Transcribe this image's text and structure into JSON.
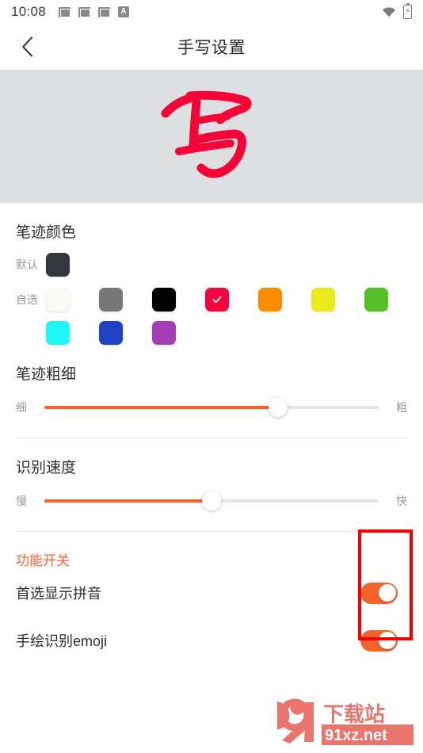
{
  "statusbar": {
    "time": "10:08",
    "left_icons": [
      "mail-icon",
      "mail-icon",
      "mail-icon",
      "a-badge-icon"
    ],
    "right_icons": [
      "wifi-icon",
      "battery-charging-icon"
    ]
  },
  "header": {
    "title": "手写设置",
    "back_icon": "chevron-left-icon"
  },
  "preview": {
    "character": "写",
    "ink_color": "#f50537",
    "background": "#dedfe0"
  },
  "ink_color_section": {
    "title": "笔迹颜色",
    "default_label": "默认",
    "custom_label": "自选",
    "default_swatch": {
      "name": "charcoal",
      "hex": "#33363c",
      "selected": false
    },
    "custom_swatches_row1": [
      {
        "name": "white",
        "hex": "#fafaf5",
        "selected": false
      },
      {
        "name": "gray",
        "hex": "#777777",
        "selected": false
      },
      {
        "name": "black",
        "hex": "#000000",
        "selected": false
      },
      {
        "name": "red",
        "hex": "#f50540",
        "selected": true
      },
      {
        "name": "orange",
        "hex": "#fb8c00",
        "selected": false
      },
      {
        "name": "yellow",
        "hex": "#e8ea1c",
        "selected": false
      },
      {
        "name": "green",
        "hex": "#55bf26",
        "selected": false
      }
    ],
    "custom_swatches_row2": [
      {
        "name": "cyan",
        "hex": "#1ff6f6",
        "selected": false
      },
      {
        "name": "blue",
        "hex": "#1e42c4",
        "selected": false
      },
      {
        "name": "purple",
        "hex": "#a33cb5",
        "selected": false
      }
    ]
  },
  "stroke_width_section": {
    "title": "笔迹粗细",
    "min_label": "细",
    "max_label": "粗",
    "value_percent": 70
  },
  "recognition_speed_section": {
    "title": "识别速度",
    "min_label": "慢",
    "max_label": "快",
    "value_percent": 50
  },
  "feature_switches": {
    "title": "功能开关",
    "accent_color": "#fa6132",
    "items": [
      {
        "label": "首选显示拼音",
        "enabled": true
      },
      {
        "label": "手绘识别emoji",
        "enabled": true
      }
    ]
  },
  "annotation": {
    "shape": "rectangle",
    "color": "#f50000"
  },
  "watermark": {
    "brand": "下载站",
    "domain": "91xz.net",
    "logo_text": "91"
  }
}
